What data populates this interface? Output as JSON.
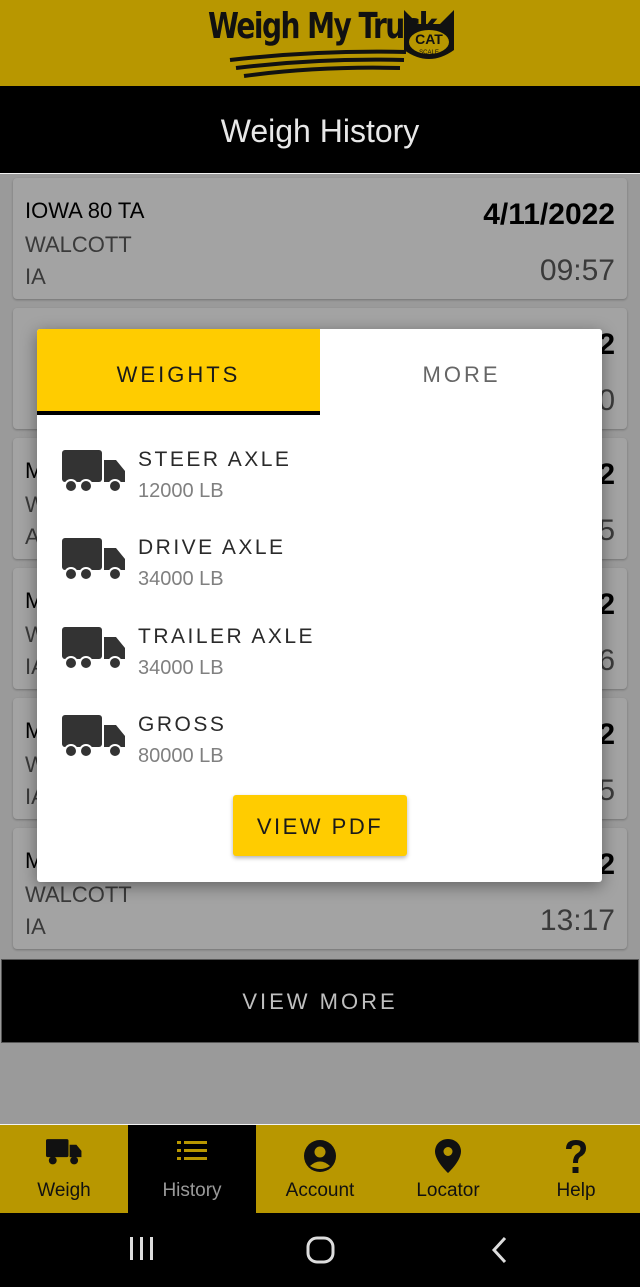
{
  "logo": {
    "text": "Weigh My Truck",
    "badge": "CAT",
    "badge_sub": "SCALE"
  },
  "page_title": "Weigh History",
  "history": [
    {
      "location": "IOWA 80 TA",
      "city": "WALCOTT",
      "state": "IA",
      "date": "4/11/2022",
      "time": "09:57"
    },
    {
      "location": "",
      "city": "",
      "state": "",
      "date": "2",
      "time": "0"
    },
    {
      "location": "M",
      "city": "W",
      "state": "A",
      "date": "2",
      "time": "5"
    },
    {
      "location": "M",
      "city": "W",
      "state": "IA",
      "date": "2",
      "time": "6"
    },
    {
      "location": "M",
      "city": "W",
      "state": "IA",
      "date": "2",
      "time": "5"
    },
    {
      "location": "M",
      "city": "WALCOTT",
      "state": "IA",
      "date": "2",
      "time": "13:17"
    }
  ],
  "view_more_label": "VIEW MORE",
  "dialog": {
    "tabs": [
      {
        "label": "WEIGHTS"
      },
      {
        "label": "MORE"
      }
    ],
    "rows": [
      {
        "label": "STEER AXLE",
        "value": "12000 LB"
      },
      {
        "label": "DRIVE AXLE",
        "value": "34000 LB"
      },
      {
        "label": "TRAILER AXLE",
        "value": "34000 LB"
      },
      {
        "label": "GROSS",
        "value": "80000 LB"
      }
    ],
    "pdf_label": "VIEW PDF"
  },
  "nav": [
    {
      "label": "Weigh",
      "icon": "truck-icon"
    },
    {
      "label": "History",
      "icon": "list-icon",
      "active": true
    },
    {
      "label": "Account",
      "icon": "account-icon"
    },
    {
      "label": "Locator",
      "icon": "location-pin-icon"
    },
    {
      "label": "Help",
      "icon": "question-icon"
    }
  ],
  "colors": {
    "brand_yellow": "#ffcc00",
    "header_gold": "#b89700",
    "black": "#000000"
  }
}
